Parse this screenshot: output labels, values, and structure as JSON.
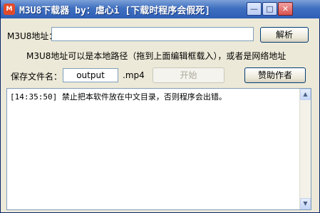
{
  "window": {
    "title": "M3U8下载器 by：虐心i [下载时程序会假死]",
    "icon_text": "M",
    "minimize_icon": "minimize-icon",
    "maximize_icon": "maximize-icon",
    "close_icon": "close-icon",
    "minimize_glyph": "—",
    "maximize_glyph": "□",
    "close_glyph": "✕"
  },
  "url_row": {
    "label": "M3U8地址：",
    "value": "",
    "parse_button": "解析"
  },
  "hint": "M3U8地址可以是本地路径（拖到上面编辑框载入），或者是网络地址",
  "file_row": {
    "label": "保存文件名：",
    "filename": "output",
    "extension": ".mp4",
    "start_button": "开始",
    "sponsor_button": "赞助作者"
  },
  "log": {
    "lines": [
      "[14:35:50] 禁止把本软件放在中文目录，否则程序会出错。"
    ],
    "scroll_up": "▲",
    "scroll_down": "▼"
  }
}
